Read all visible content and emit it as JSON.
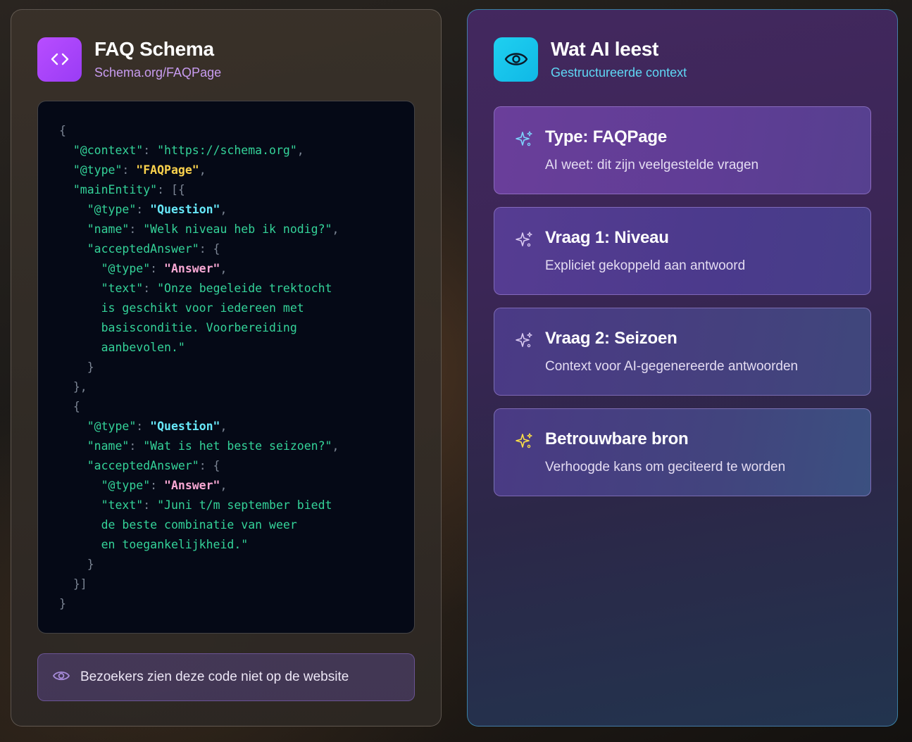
{
  "left": {
    "title": "FAQ Schema",
    "subtitle": "Schema.org/FAQPage",
    "icon": "code-brackets-icon",
    "code_lines": [
      [
        {
          "t": "{",
          "c": "punc"
        }
      ],
      [
        {
          "t": "  \"@context\"",
          "c": "key"
        },
        {
          "t": ": ",
          "c": "punc"
        },
        {
          "t": "\"https://schema.org\"",
          "c": "str"
        },
        {
          "t": ",",
          "c": "punc"
        }
      ],
      [
        {
          "t": "  \"@type\"",
          "c": "key"
        },
        {
          "t": ": ",
          "c": "punc"
        },
        {
          "t": "\"FAQPage\"",
          "c": "yellow"
        },
        {
          "t": ",",
          "c": "punc"
        }
      ],
      [
        {
          "t": "  \"mainEntity\"",
          "c": "key"
        },
        {
          "t": ": [{",
          "c": "punc"
        }
      ],
      [
        {
          "t": "    \"@type\"",
          "c": "key"
        },
        {
          "t": ": ",
          "c": "punc"
        },
        {
          "t": "\"Question\"",
          "c": "cyan"
        },
        {
          "t": ",",
          "c": "punc"
        }
      ],
      [
        {
          "t": "    \"name\"",
          "c": "key"
        },
        {
          "t": ": ",
          "c": "punc"
        },
        {
          "t": "\"Welk niveau heb ik nodig?\"",
          "c": "str"
        },
        {
          "t": ",",
          "c": "punc"
        }
      ],
      [
        {
          "t": "    \"acceptedAnswer\"",
          "c": "key"
        },
        {
          "t": ": {",
          "c": "punc"
        }
      ],
      [
        {
          "t": "      \"@type\"",
          "c": "key"
        },
        {
          "t": ": ",
          "c": "punc"
        },
        {
          "t": "\"Answer\"",
          "c": "pink"
        },
        {
          "t": ",",
          "c": "punc"
        }
      ],
      [
        {
          "t": "      \"text\"",
          "c": "key"
        },
        {
          "t": ": ",
          "c": "punc"
        },
        {
          "t": "\"Onze begeleide trektocht",
          "c": "str"
        }
      ],
      [
        {
          "t": "      is geschikt voor iedereen met",
          "c": "str"
        }
      ],
      [
        {
          "t": "      basisconditie. Voorbereiding",
          "c": "str"
        }
      ],
      [
        {
          "t": "      aanbevolen.\"",
          "c": "str"
        }
      ],
      [
        {
          "t": "    }",
          "c": "punc"
        }
      ],
      [
        {
          "t": "  },",
          "c": "punc"
        }
      ],
      [
        {
          "t": "  {",
          "c": "punc"
        }
      ],
      [
        {
          "t": "    \"@type\"",
          "c": "key"
        },
        {
          "t": ": ",
          "c": "punc"
        },
        {
          "t": "\"Question\"",
          "c": "cyan"
        },
        {
          "t": ",",
          "c": "punc"
        }
      ],
      [
        {
          "t": "    \"name\"",
          "c": "key"
        },
        {
          "t": ": ",
          "c": "punc"
        },
        {
          "t": "\"Wat is het beste seizoen?\"",
          "c": "str"
        },
        {
          "t": ",",
          "c": "punc"
        }
      ],
      [
        {
          "t": "    \"acceptedAnswer\"",
          "c": "key"
        },
        {
          "t": ": {",
          "c": "punc"
        }
      ],
      [
        {
          "t": "      \"@type\"",
          "c": "key"
        },
        {
          "t": ": ",
          "c": "punc"
        },
        {
          "t": "\"Answer\"",
          "c": "pink"
        },
        {
          "t": ",",
          "c": "punc"
        }
      ],
      [
        {
          "t": "      \"text\"",
          "c": "key"
        },
        {
          "t": ": ",
          "c": "punc"
        },
        {
          "t": "\"Juni t/m september biedt",
          "c": "str"
        }
      ],
      [
        {
          "t": "      de beste combinatie van weer",
          "c": "str"
        }
      ],
      [
        {
          "t": "      en toegankelijkheid.\"",
          "c": "str"
        }
      ],
      [
        {
          "t": "    }",
          "c": "punc"
        }
      ],
      [
        {
          "t": "  }]",
          "c": "punc"
        }
      ],
      [
        {
          "t": "}",
          "c": "punc"
        }
      ]
    ],
    "notice": {
      "icon": "eye-icon",
      "text": "Bezoekers zien deze code niet op de website"
    }
  },
  "right": {
    "title": "Wat AI leest",
    "subtitle": "Gestructureerde context",
    "icon": "eye-icon",
    "cards": [
      {
        "icon": "sparkle-icon",
        "icon_color": "#7dd3fc",
        "title": "Type: FAQPage",
        "desc": "AI weet: dit zijn veelgestelde vragen"
      },
      {
        "icon": "sparkle-icon",
        "icon_color": "#d8c8f0",
        "title": "Vraag 1: Niveau",
        "desc": "Expliciet gekoppeld aan antwoord"
      },
      {
        "icon": "sparkle-icon",
        "icon_color": "#d8c8f0",
        "title": "Vraag 2: Seizoen",
        "desc": "Context voor AI-gegenereerde antwoorden"
      },
      {
        "icon": "sparkle-icon",
        "icon_color": "#fde047",
        "title": "Betrouwbare bron",
        "desc": "Verhoogde kans om geciteerd te worden"
      }
    ]
  },
  "colors": {
    "code_key": "#34d399",
    "code_yellow": "#fcd34d",
    "code_cyan": "#67e8f9",
    "code_pink": "#f9a8d4",
    "accent_purple": "#b84dff",
    "accent_cyan": "#1fd0f0"
  }
}
